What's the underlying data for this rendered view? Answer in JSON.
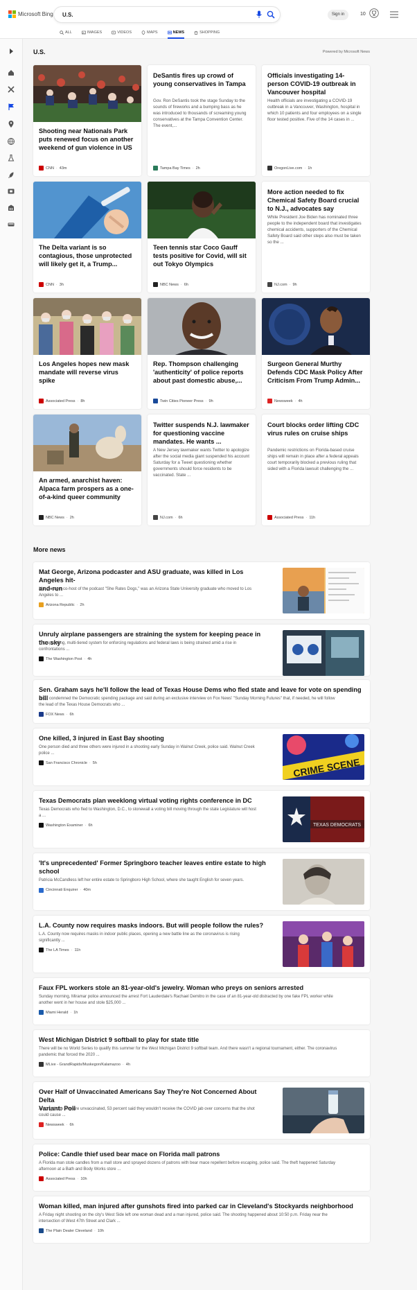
{
  "header": {
    "brand": "Microsoft Bing",
    "search_value": "U.S.",
    "signin_label": "Sign in",
    "rewards_count": "10",
    "tabs": [
      {
        "label": "ALL",
        "icon": "search-icon"
      },
      {
        "label": "IMAGES",
        "icon": "image-icon"
      },
      {
        "label": "VIDEOS",
        "icon": "video-icon"
      },
      {
        "label": "MAPS",
        "icon": "map-pin-icon"
      },
      {
        "label": "NEWS",
        "icon": "news-icon",
        "active": true
      },
      {
        "label": "SHOPPING",
        "icon": "shopping-bag-icon"
      }
    ]
  },
  "sidebar": {
    "icons": [
      "expand-arrow-icon",
      "home-icon",
      "crossed-tools-icon",
      "flag-icon",
      "location-pin-icon",
      "globe-icon",
      "flask-icon",
      "rocket-icon",
      "movie-icon",
      "building-icon",
      "car-icon"
    ]
  },
  "section": {
    "title": "U.S.",
    "powered_by": "Powered by Microsoft News"
  },
  "cards": [
    {
      "title": "Shooting near Nationals Park puts renewed focus on another weekend of gun violence in US",
      "source": "CNN",
      "time": "43m",
      "logo_color": "#cc0000",
      "image": "baseball-crowd"
    },
    {
      "title": "DeSantis fires up crowd of young conservatives in Tampa",
      "snippet": "Gov. Ron DeSantis took the stage Sunday to the sounds of fireworks and a bumping bass as he was introduced to thousands of screaming young conservatives at the Tampa Convention Center. The event,...",
      "source": "Tampa Bay Times",
      "time": "2h",
      "logo_color": "#2a7a5a"
    },
    {
      "title": "Officials investigating 14-person COVID-19 outbreak in Vancouver hospital",
      "snippet": "Health officials are investigating a COVID-19 outbreak in a Vancouver, Washington, hospital in which 10 patients and four employees on a single floor tested positive. Five of the 14 cases in ...",
      "source": "OregonLive.com",
      "time": "1h",
      "logo_color": "#333333"
    },
    {
      "title": "The Delta variant is so contagious, those unprotected will likely get it, a Trump...",
      "source": "CNN",
      "time": "3h",
      "logo_color": "#cc0000",
      "image": "vaccine"
    },
    {
      "title": "Teen tennis star Coco Gauff tests positive for Covid, will sit out Tokyo Olympics",
      "source": "NBC News",
      "time": "6h",
      "logo_color": "#222222",
      "image": "tennis"
    },
    {
      "title": "More action needed to fix Chemical Safety Board crucial to N.J., advocates say",
      "snippet": "While President Joe Biden has nominated three people to the independent board that investigates chemical accidents, supporters of the Chemical Safety Board said other steps also must be taken so the ...",
      "source": "NJ.com",
      "time": "9h",
      "logo_color": "#444444"
    },
    {
      "title": "Los Angeles hopes new mask mandate will reverse virus spike",
      "source": "Associated Press",
      "time": "8h",
      "logo_color": "#cc0000",
      "image": "crowd-masks"
    },
    {
      "title": "Rep. Thompson challenging 'authenticity' of police reports about past domestic abuse,...",
      "source": "Twin Cities Pioneer Press",
      "time": "9h",
      "logo_color": "#1a4a9a",
      "image": "portrait-smile"
    },
    {
      "title": "Surgeon General Murthy Defends CDC Mask Policy After Criticism From Trump Admin...",
      "source": "Newsweek",
      "time": "4h",
      "logo_color": "#dd2222",
      "image": "podium"
    },
    {
      "title": "An armed, anarchist haven: Alpaca farm prospers as a one-of-a-kind queer community",
      "source": "NBC News",
      "time": "2h",
      "logo_color": "#222222",
      "image": "alpaca"
    },
    {
      "title": "Twitter suspends N.J. lawmaker for questioning vaccine mandates. He wants ...",
      "snippet": "A New Jersey lawmaker wants Twitter to apologize after the social media giant suspended his account Saturday for a Tweet questioning whether governments should force residents to be vaccinated. State ...",
      "source": "NJ.com",
      "time": "6h",
      "logo_color": "#444444"
    },
    {
      "title": "Court blocks order lifting CDC virus rules on cruise ships",
      "snippet": "Pandemic restrictions on Florida-based cruise ships will remain in place after a federal appeals court temporarily blocked a previous ruling that sided with a Florida lawsuit challenging the ...",
      "source": "Associated Press",
      "time": "11h",
      "logo_color": "#cc0000"
    }
  ],
  "more_news": {
    "title": "More news",
    "items": [
      {
        "title": [
          "Mat George, Arizona podcaster and ASU graduate, was killed in Los Angeles hit-",
          "and-run"
        ],
        "snippet": [
          "Mat George, co-host of the podcast \"She Rates Dogs,\" was an Arizona State University graduate who moved to Los",
          "Angeles to ..."
        ],
        "source": "Arizona Republic",
        "time": "2h",
        "logo_color": "#e8a020",
        "image": "beach-portrait"
      },
      {
        "title": [
          "Unruly airplane passengers are straining the system for keeping peace in the sky"
        ],
        "snippet": [
          "The sprawling, multi-tiered system for enforcing regulations and federal laws is being strained amid a rise in",
          "confrontations ..."
        ],
        "source": "The Washington Post",
        "time": "4h",
        "logo_color": "#111111",
        "image": "airport"
      },
      {
        "title": [
          "Sen. Graham says he'll follow the lead of Texas House Dems who fled state and leave for vote on spending bill"
        ],
        "snippet": [
          "S.C., condemned the Democratic spending package and said during an exclusive interview on Fox News' \"Sunday Morning Futures\" that, if needed, he will follow",
          "the lead of the Texas House Democrats who ..."
        ],
        "source": "FOX News",
        "time": "6h",
        "logo_color": "#1a3a8a"
      },
      {
        "title": [
          "One killed, 3 injured in East Bay shooting"
        ],
        "snippet": [
          "One person died and three others were injured in a shooting early Sunday in Walnut Creek, police said. Walnut Creek",
          "police ..."
        ],
        "source": "San Francisco Chronicle",
        "time": "5h",
        "logo_color": "#111111",
        "image": "crime-scene"
      },
      {
        "title": [
          "Texas Democrats plan weeklong virtual voting rights conference in DC"
        ],
        "snippet": [
          "Texas Democrats who fled to Washington, D.C., to stonewall a voting bill moving through the state Legislature will host",
          "a ..."
        ],
        "source": "Washington Examiner",
        "time": "6h",
        "logo_color": "#111111",
        "image": "texas-democrats"
      },
      {
        "title": [
          "'It's unprecedented' Former Springboro teacher leaves entire estate to high",
          "school"
        ],
        "snippet": [
          "Patricia McCandless left her entire estate to Springboro High School, where she taught English for seven years."
        ],
        "source": "Cincinnati Enquirer",
        "time": "40m",
        "logo_color": "#2a6acc",
        "image": "vintage-portrait"
      },
      {
        "title": [
          "L.A. County now requires masks indoors. But will people follow the rules?"
        ],
        "snippet": [
          "L.A. County now requires masks in indoor public places, opening a new battle line as the coronavirus is rising",
          "significantly ..."
        ],
        "source": "The LA Times",
        "time": "11h",
        "logo_color": "#111111",
        "image": "masked-shoppers"
      },
      {
        "title": [
          "Faux FPL workers stole an 81-year-old's jewelry. Woman who preys on seniors arrested"
        ],
        "snippet": [
          "Sunday morning, Miramar police announced the arrest Fort Lauderdale's Rachael Demitro in the case of an 81-year-old distracted by one fake FPL worker while",
          "another went in her house and stole $25,000 ..."
        ],
        "source": "Miami Herald",
        "time": "1h",
        "logo_color": "#1a5aaa"
      },
      {
        "title": [
          "West Michigan District 9 softball to play for state title"
        ],
        "snippet": [
          "There will be no World Series to qualify this summer for the West Michigan District 9 softball team. And there wasn't a regional tournament, either. The coronavirus",
          "pandemic that forced the 2020 ..."
        ],
        "source": "MLive - GrandRapids/Muskegon/Kalamazoo",
        "time": "4h",
        "logo_color": "#333333"
      },
      {
        "title": [
          "Over Half of Unvaccinated Americans Say They're Not Concerned About Delta",
          "Variant: Poll"
        ],
        "snippet": [
          "Among those who are unvaccinated, 53 percent said they wouldn't receive the COVID jab over concerns that the shot",
          "could cause ..."
        ],
        "source": "Newsweek",
        "time": "6h",
        "logo_color": "#dd2222",
        "image": "vaccine-vial"
      },
      {
        "title": [
          "Police: Candle thief used bear mace on Florida mall patrons"
        ],
        "snippet": [
          "A Florida man stole candles from a mall store and sprayed dozens of patrons with bear mace repellent before escaping, police said. The theft happened Saturday",
          "afternoon at a Bath and Body Works store ..."
        ],
        "source": "Associated Press",
        "time": "10h",
        "logo_color": "#cc0000"
      },
      {
        "title": [
          "Woman killed, man injured after gunshots fired into parked car in Cleveland's Stockyards neighborhood"
        ],
        "snippet": [
          "A Friday night shooting on the city's West Side left one woman dead and a man injured, police said. The shooting happened about 10:50 p.m. Friday near the",
          "intersection of West 47th Street and Clark ..."
        ],
        "source": "The Plain Dealer Cleveland",
        "time": "10h",
        "logo_color": "#1a4a8a"
      }
    ]
  }
}
